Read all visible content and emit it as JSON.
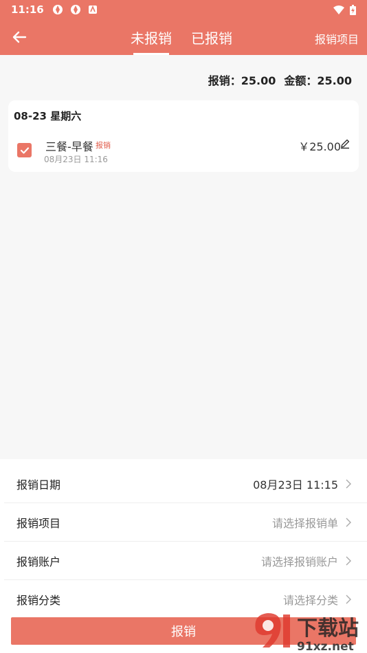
{
  "status_bar": {
    "time": "11:16"
  },
  "header": {
    "tabs": [
      {
        "label": "未报销",
        "active": true
      },
      {
        "label": "已报销",
        "active": false
      }
    ],
    "right_link": "报销项目"
  },
  "summary": {
    "count_label": "报销：",
    "count_value": "25.00",
    "amount_label": "金额：",
    "amount_value": "25.00"
  },
  "records": [
    {
      "date": "08-23 星期六",
      "items": [
        {
          "name": "三餐-早餐",
          "tag": "报销",
          "time": "08月23日 11:16",
          "amount": "￥25.00",
          "checked": true
        }
      ]
    }
  ],
  "form": {
    "rows": [
      {
        "label": "报销日期",
        "value": "08月23日 11:15",
        "is_placeholder": false
      },
      {
        "label": "报销项目",
        "value": "请选择报销单",
        "is_placeholder": true
      },
      {
        "label": "报销账户",
        "value": "请选择报销账户",
        "is_placeholder": true
      },
      {
        "label": "报销分类",
        "value": "请选择分类",
        "is_placeholder": true
      }
    ]
  },
  "submit_label": "报销",
  "watermark": {
    "brand": "下载站",
    "site": "91xz.net"
  },
  "colors": {
    "accent": "#ea7666",
    "tag": "#e05a48",
    "background": "#f7f7f7"
  }
}
